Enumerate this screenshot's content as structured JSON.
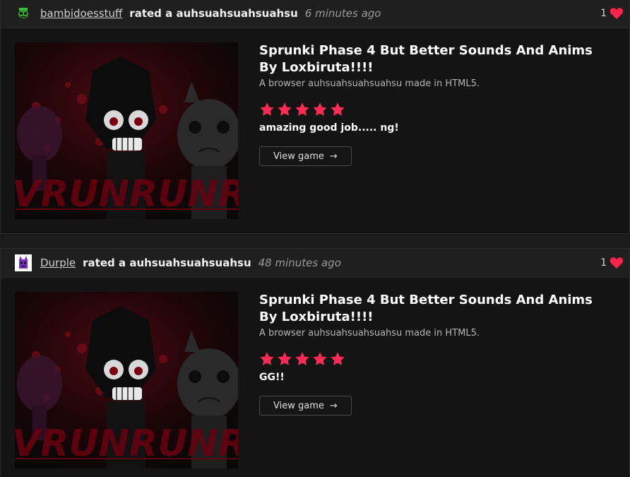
{
  "events": [
    {
      "user": "bambidoesstuff",
      "action": "rated a auhsuahsuahsuahsu",
      "time": "6 minutes ago",
      "likes": "1",
      "avatar_icon": "green-character-avatar",
      "game": {
        "title": "Sprunki Phase 4 But Better Sounds And Anims By Loxbiruta!!!!",
        "description": "A browser auhsuahsuahsuahsu made in HTML5.",
        "rating": 5,
        "review": "amazing good job..... ng!",
        "button_label": "View game",
        "thumbnail_text": "VRUNRUNRUNRUN"
      }
    },
    {
      "user": "Durple",
      "action": "rated a auhsuahsuahsuahsu",
      "time": "48 minutes ago",
      "likes": "1",
      "avatar_icon": "purple-character-avatar",
      "game": {
        "title": "Sprunki Phase 4 But Better Sounds And Anims By Loxbiruta!!!!",
        "description": "A browser auhsuahsuahsuahsu made in HTML5.",
        "rating": 5,
        "review": "GG!!",
        "button_label": "View game",
        "thumbnail_text": "VRUNRUNRUNRUN"
      }
    }
  ],
  "colors": {
    "star": "#ff2a55",
    "heart": "#ff2449",
    "background": "#141414"
  },
  "icons": {
    "heart": "heart-icon",
    "star": "star-icon",
    "arrow": "→"
  }
}
